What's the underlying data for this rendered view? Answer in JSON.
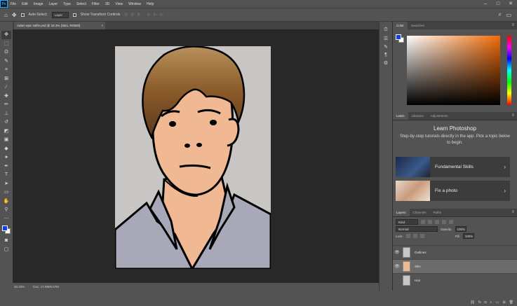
{
  "menu": {
    "logo": "Ps",
    "items": [
      "File",
      "Edit",
      "Image",
      "Layer",
      "Type",
      "Select",
      "Filter",
      "3D",
      "View",
      "Window",
      "Help"
    ]
  },
  "window": {
    "minimize": "–",
    "maximize": "□",
    "close": "✕"
  },
  "options": {
    "auto_select_label": "Auto-Select:",
    "auto_select_value": "Layer",
    "transform_label": "Show Transform Controls",
    "align_icons": "⊪⊪⊪ ⊫⊫⊫ ···"
  },
  "document": {
    "tab_title": "Adam epic selfie.psd @ 33.3% (Skin, RGB/8)",
    "tab_close": "×"
  },
  "status": {
    "zoom": "33.33%",
    "doc_size": "Doc: 17.9M/9.67M"
  },
  "color_panel": {
    "tabs": [
      "Color",
      "Swatches"
    ],
    "foreground": "#0d3ef5",
    "background": "#ffffff",
    "picker_hue": "#f26b08"
  },
  "learn_panel": {
    "tabs": [
      "Learn",
      "Libraries",
      "Adjustments"
    ],
    "title": "Learn Photoshop",
    "description": "Step-by-step tutorials directly in the app. Pick a topic below to begin.",
    "cards": [
      {
        "label": "Fundamental Skills",
        "chevron": "›"
      },
      {
        "label": "Fix a photo",
        "chevron": "›"
      }
    ]
  },
  "layers_panel": {
    "tabs": [
      "Layers",
      "Channels",
      "Paths"
    ],
    "kind_label": "Kind",
    "blend_mode": "Normal",
    "opacity_label": "Opacity:",
    "opacity_value": "100%",
    "lock_label": "Lock:",
    "fill_label": "Fill:",
    "fill_value": "100%",
    "layers": [
      {
        "name": "Outlines",
        "visible": true,
        "selected": false
      },
      {
        "name": "Skin",
        "visible": true,
        "selected": true
      },
      {
        "name": "Hair",
        "visible": false,
        "selected": false
      }
    ]
  },
  "panel_menu": "≡",
  "colors": {
    "accent_blue": "#0d3ef5",
    "skin": "#f0b893",
    "shirt": "#a9a8b9",
    "canvas_bg": "#c8c6c4"
  }
}
